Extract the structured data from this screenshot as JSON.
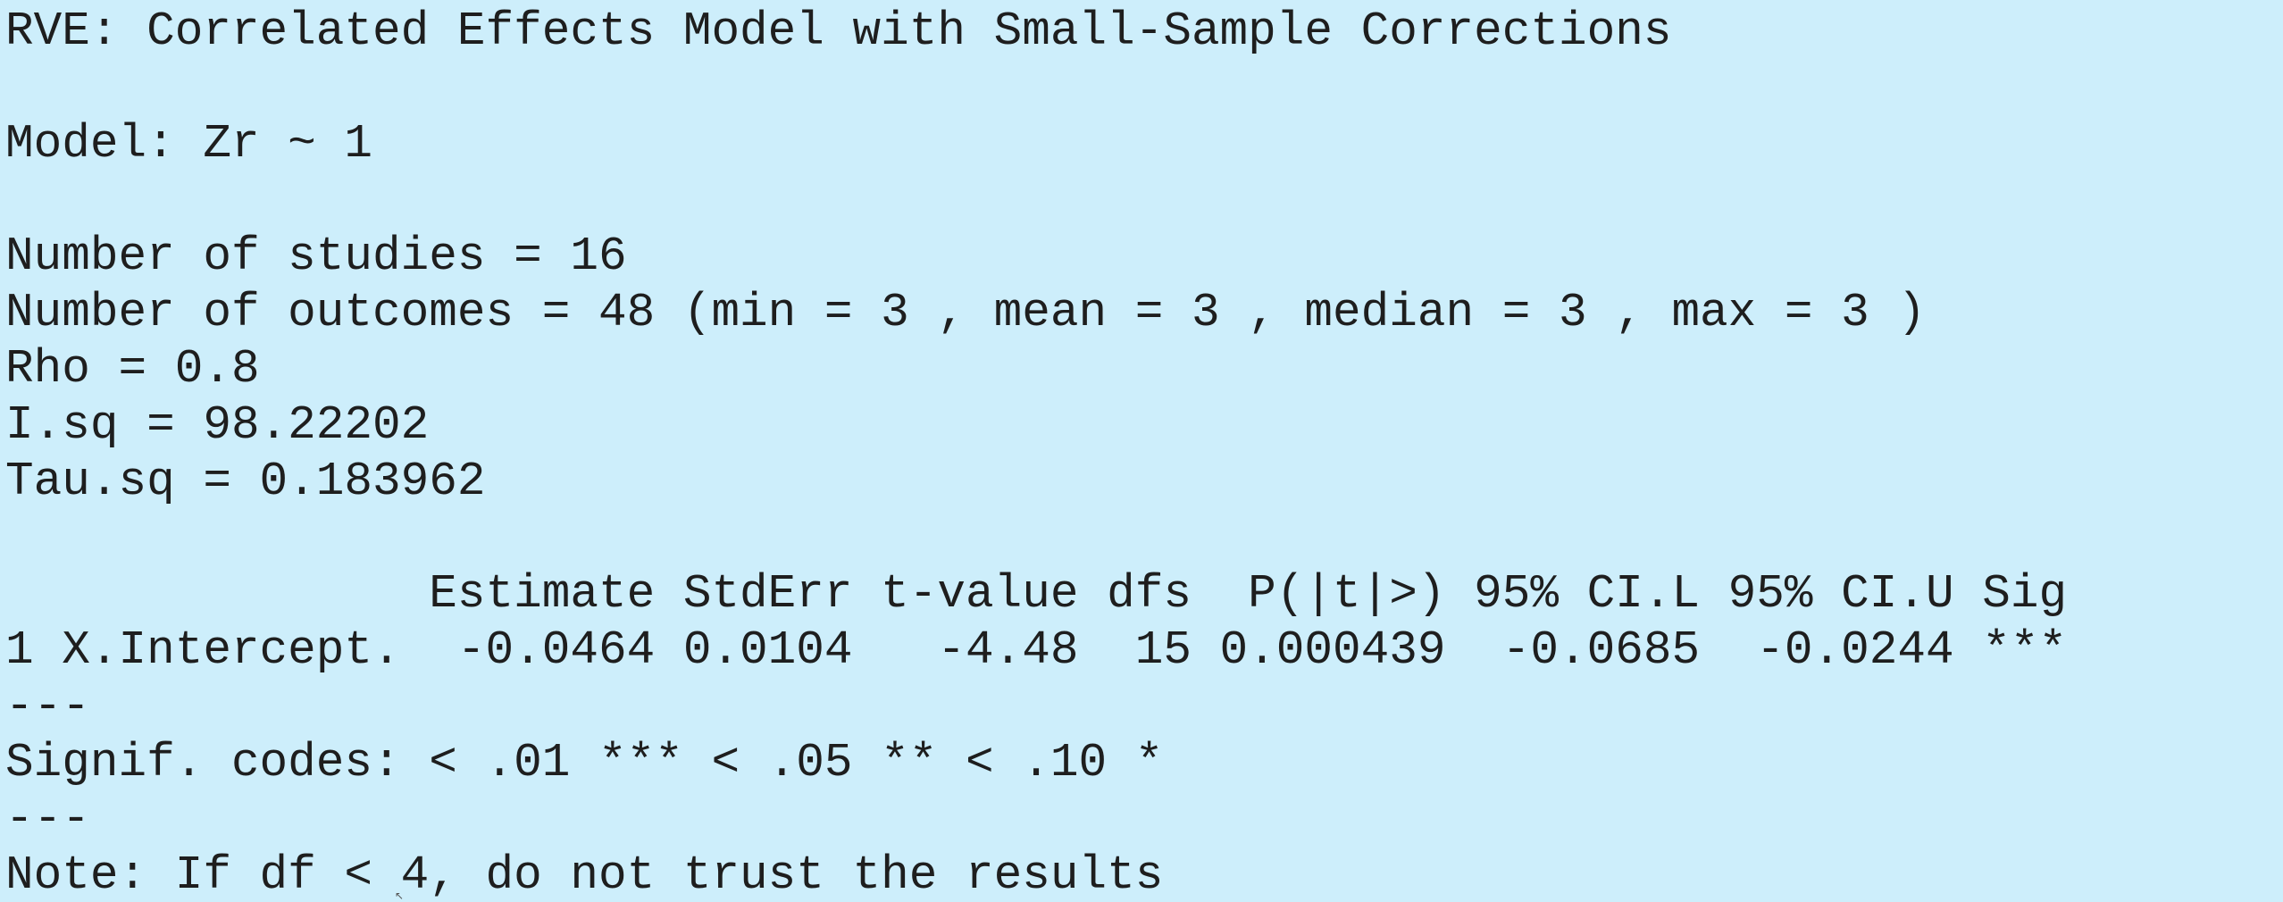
{
  "console": {
    "title": "RVE: Correlated Effects Model with Small-Sample Corrections",
    "model": "Model: Zr ~ 1",
    "n_studies": "Number of studies = 16",
    "n_outcomes": "Number of outcomes = 48 (min = 3 , mean = 3 , median = 3 , max = 3 )",
    "rho": "Rho = 0.8",
    "isq": "I.sq = 98.22202",
    "tausq": "Tau.sq = 0.183962",
    "table_header": "               Estimate StdErr t-value dfs  P(|t|>) 95% CI.L 95% CI.U Sig",
    "table_row_1": "1 X.Intercept.  -0.0464 0.0104   -4.48  15 0.000439  -0.0685  -0.0244 ***",
    "separator_1": "---",
    "signif_codes": "Signif. codes: < .01 *** < .05 ** < .10 *",
    "separator_2": "---",
    "note": "Note: If df < 4, do not trust the results"
  },
  "colors": {
    "background": "#cdeefb",
    "text": "#1e1e1e"
  }
}
